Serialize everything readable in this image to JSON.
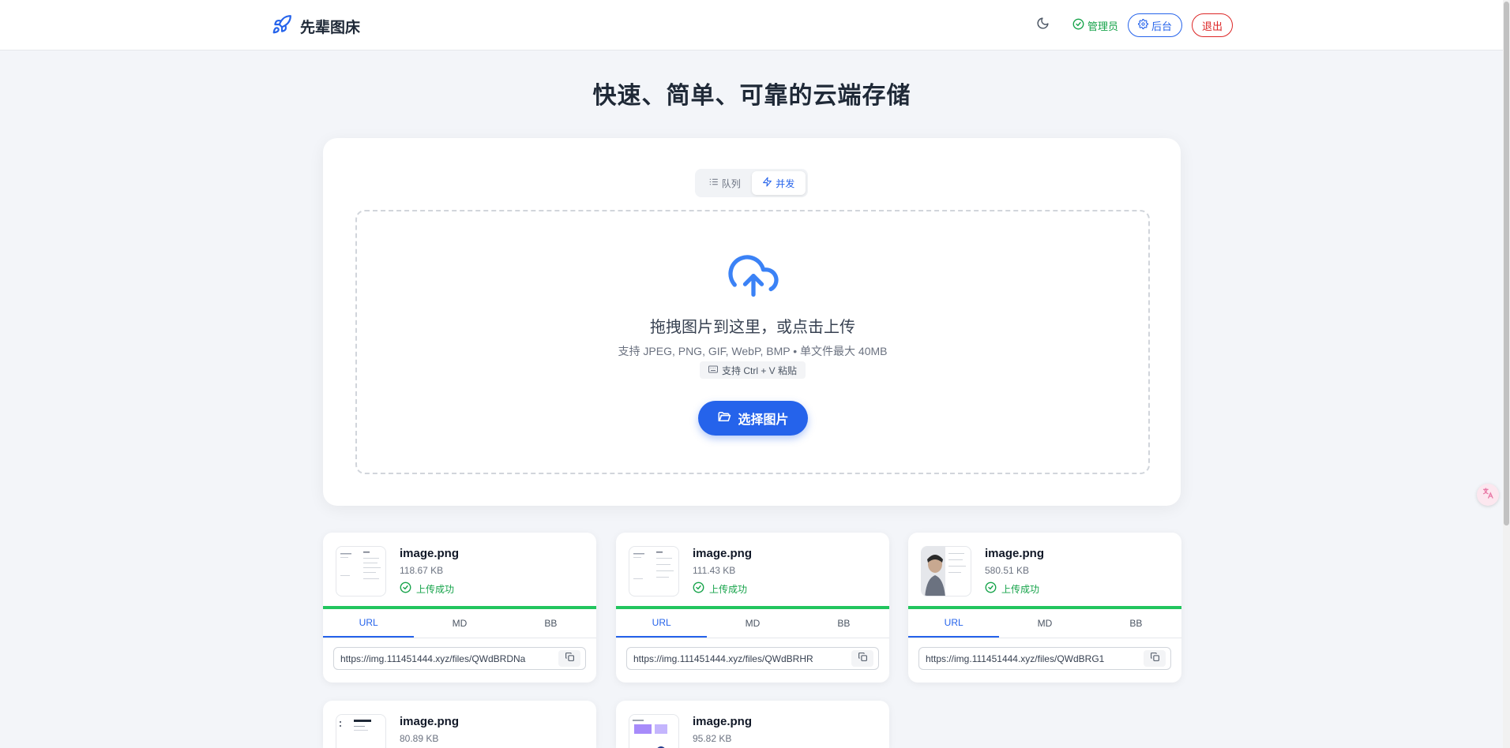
{
  "header": {
    "brand_name": "先辈图床",
    "admin_label": "管理员",
    "backend_label": "后台",
    "logout_label": "退出"
  },
  "hero": {
    "title": "快速、简单、可靠的云端存储"
  },
  "upload": {
    "modes": [
      {
        "label": "队列",
        "active": false
      },
      {
        "label": "并发",
        "active": true
      }
    ],
    "drop_title": "拖拽图片到这里，或点击上传",
    "drop_subtitle": "支持 JPEG, PNG, GIF, WebP, BMP  •  单文件最大 40MB",
    "paste_hint": "支持 Ctrl + V 粘贴",
    "select_button": "选择图片"
  },
  "results": [
    {
      "name": "image.png",
      "size": "118.67 KB",
      "status": "上传成功",
      "progress": 1.0,
      "tabs": [
        "URL",
        "MD",
        "BB"
      ],
      "url": "https://img.111451444.xyz/files/QWdBRDNa"
    },
    {
      "name": "image.png",
      "size": "111.43 KB",
      "status": "上传成功",
      "progress": 1.0,
      "tabs": [
        "URL",
        "MD",
        "BB"
      ],
      "url": "https://img.111451444.xyz/files/QWdBRHR"
    },
    {
      "name": "image.png",
      "size": "580.51 KB",
      "status": "上传成功",
      "progress": 1.0,
      "tabs": [
        "URL",
        "MD",
        "BB"
      ],
      "url": "https://img.111451444.xyz/files/QWdBRG1"
    },
    {
      "name": "image.png",
      "size": "80.89 KB"
    },
    {
      "name": "image.png",
      "size": "95.82 KB"
    }
  ],
  "colors": {
    "accent": "#2563eb",
    "success": "#16a34a",
    "danger": "#dc2626"
  },
  "icons": [
    "rocket-icon",
    "moon-icon",
    "check-circle-icon",
    "gear-icon",
    "list-icon",
    "zap-icon",
    "cloud-upload-icon",
    "keyboard-icon",
    "folder-open-icon",
    "copy-icon",
    "translate-icon"
  ]
}
